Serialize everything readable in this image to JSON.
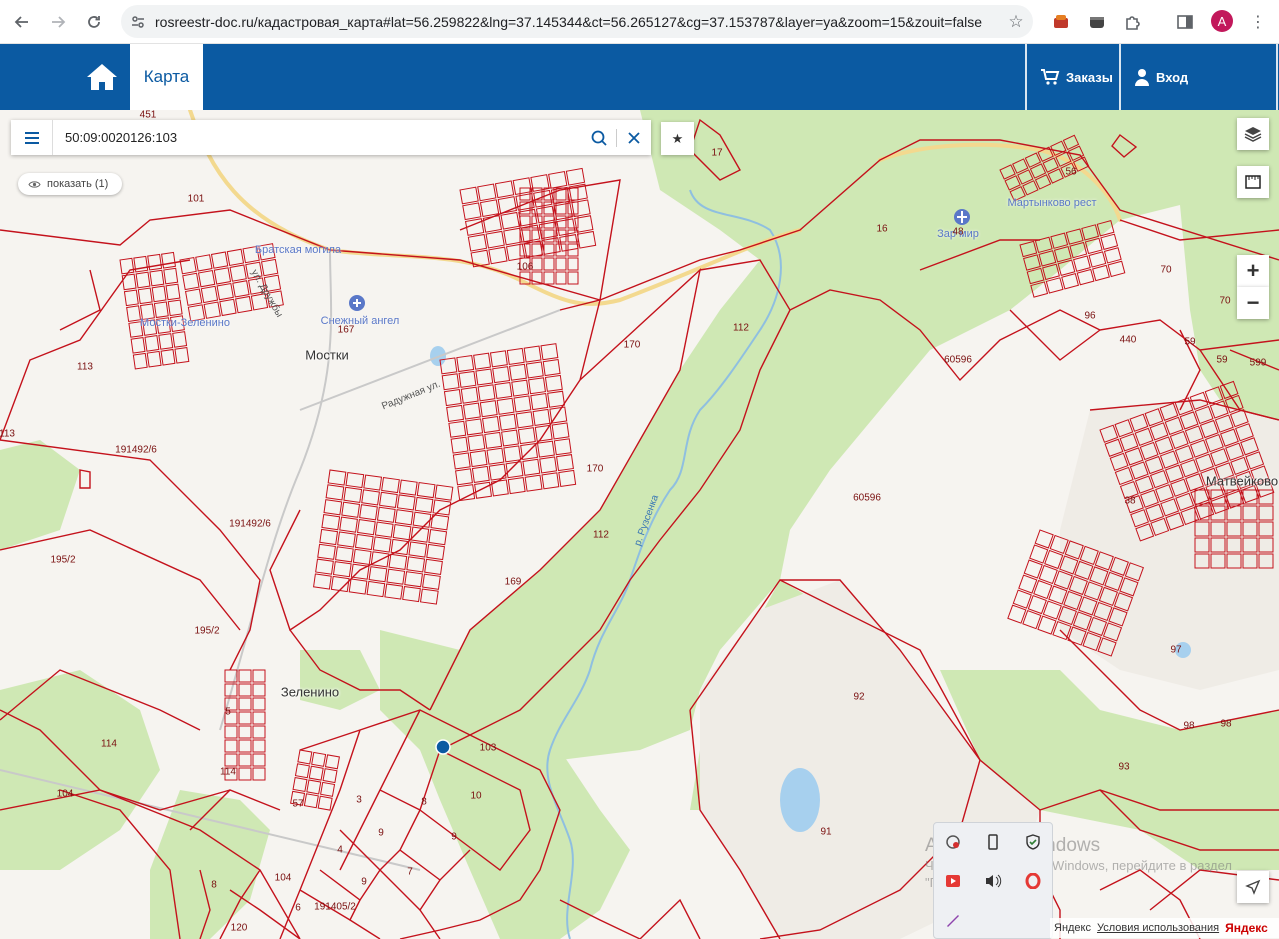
{
  "browser": {
    "url": "rosreestr-doc.ru/кадастровая_карта#lat=56.259822&lng=37.145344&ct=56.265127&cg=37.153787&layer=ya&zoom=15&zouit=false",
    "avatar_letter": "A"
  },
  "header": {
    "map_tab": "Карта",
    "orders_label": "Заказы",
    "login_label": "Вход",
    "brand_color": "#0b5aa2"
  },
  "search": {
    "value": "50:09:0020126:103",
    "show_chip": "показать (1)"
  },
  "map": {
    "places": [
      {
        "id": "mostki",
        "text": "Мостки"
      },
      {
        "id": "zelenino",
        "text": "Зеленино"
      },
      {
        "id": "matveykovo",
        "text": "Матвейково"
      },
      {
        "id": "brotherly-grave",
        "text": "Братская могила"
      },
      {
        "id": "snow-angel",
        "text": "Снежный ангел"
      },
      {
        "id": "mostki-zelenino",
        "text": "Мостки-Зеленино"
      },
      {
        "id": "zar-mir",
        "text": "Зар мир"
      },
      {
        "id": "martynkovo",
        "text": "Мартынково рест"
      }
    ],
    "streets": [
      {
        "id": "druzhby",
        "text": "ул. Дружбы"
      },
      {
        "id": "raduzhnaya",
        "text": "Радужная ул."
      },
      {
        "id": "river",
        "text": "р. Рузсенка"
      }
    ],
    "parcel_numbers": [
      "451",
      "101",
      "17",
      "16",
      "56",
      "48",
      "70",
      "70",
      "59",
      "59",
      "599",
      "106",
      "167",
      "170",
      "112",
      "60596",
      "113",
      "113",
      "191492/6",
      "170",
      "60596",
      "38",
      "191492/6",
      "112",
      "195/2",
      "169",
      "195/2",
      "97",
      "98",
      "98",
      "92",
      "5",
      "114",
      "114",
      "103",
      "104",
      "57",
      "3",
      "8",
      "10",
      "93",
      "9",
      "9",
      "91",
      "4",
      "7",
      "8",
      "104",
      "6",
      "191405/2",
      "9",
      "120",
      "440",
      "96"
    ],
    "selected_parcel": "50:09:0020126:103"
  },
  "watermark": {
    "title": "Активация Windows",
    "text": "Чтобы активировать Windows, перейдите в раздел \"Параметры\"."
  },
  "footer": {
    "copyright": "Яндекс",
    "terms": "Условия использования",
    "logo": "Яндекс"
  }
}
